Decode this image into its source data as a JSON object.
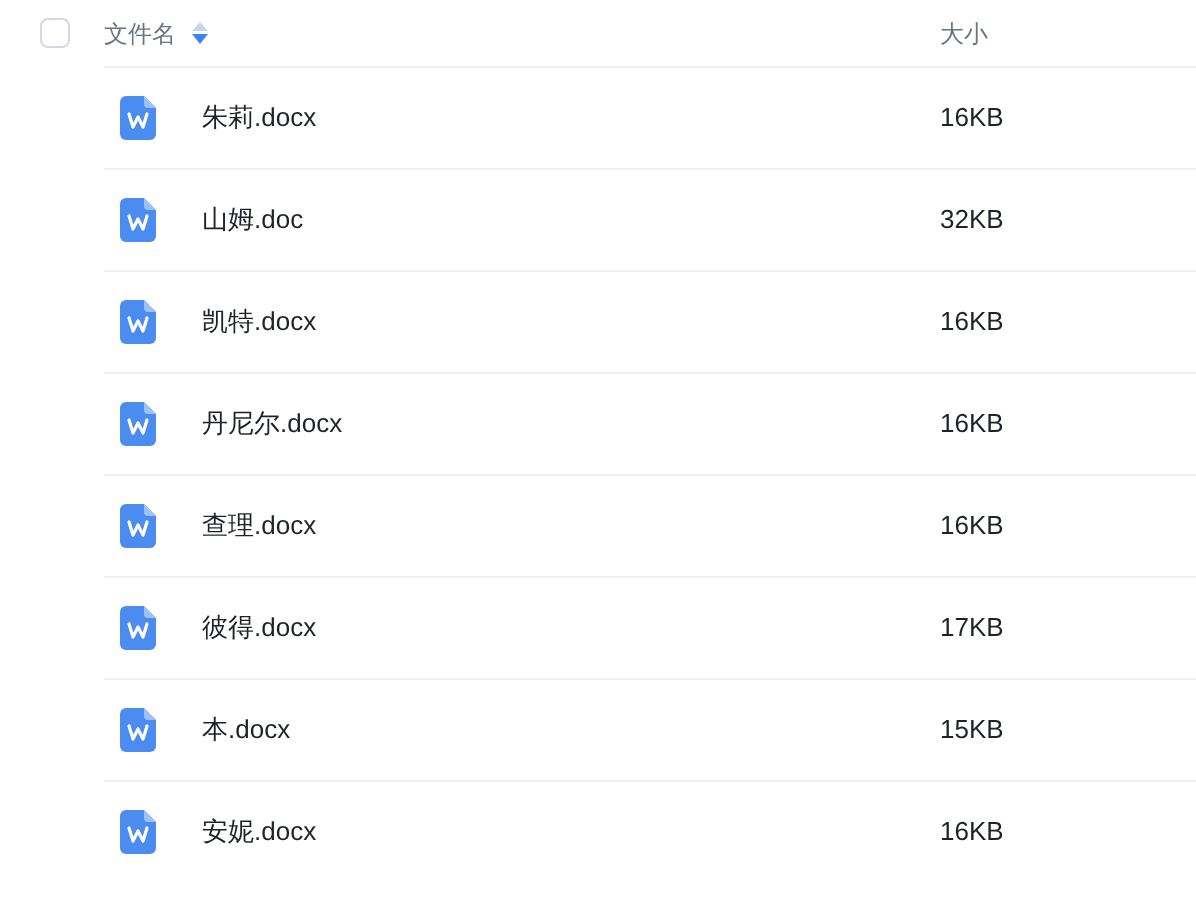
{
  "header": {
    "checked": false,
    "name_label": "文件名",
    "sort_descending": true,
    "size_label": "大小"
  },
  "files": [
    {
      "name": "朱莉.docx",
      "size": "16KB"
    },
    {
      "name": "山姆.doc",
      "size": "32KB"
    },
    {
      "name": "凯特.docx",
      "size": "16KB"
    },
    {
      "name": "丹尼尔.docx",
      "size": "16KB"
    },
    {
      "name": "查理.docx",
      "size": "16KB"
    },
    {
      "name": "彼得.docx",
      "size": "17KB"
    },
    {
      "name": "本.docx",
      "size": "15KB"
    },
    {
      "name": "安妮.docx",
      "size": "16KB"
    }
  ]
}
